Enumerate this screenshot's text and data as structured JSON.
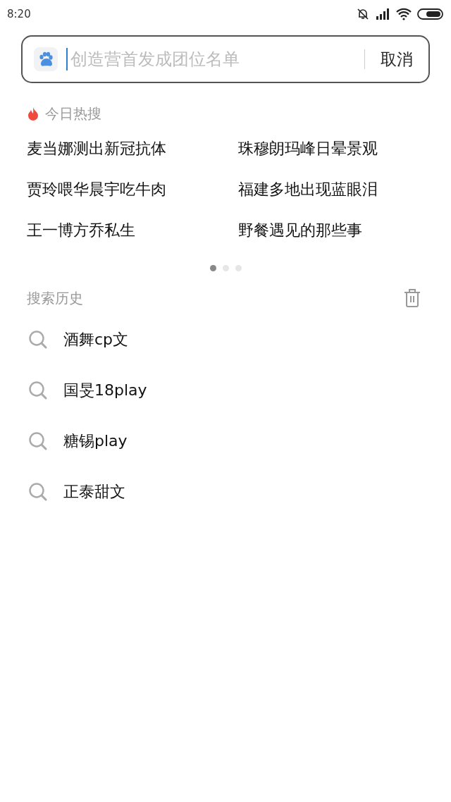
{
  "status_bar": {
    "time": "8:20"
  },
  "search": {
    "placeholder": "创造营首发成团位名单",
    "cancel": "取消"
  },
  "hot_search": {
    "title": "今日热搜",
    "items": [
      "麦当娜测出新冠抗体",
      "珠穆朗玛峰日晕景观",
      "贾玲喂华晨宇吃牛肉",
      "福建多地出现蓝眼泪",
      "王一博方乔私生",
      "野餐遇见的那些事"
    ],
    "pages": [
      {
        "selected": true
      },
      {
        "selected": false
      },
      {
        "selected": false
      }
    ]
  },
  "history": {
    "title": "搜索历史",
    "items": [
      "酒舞cp文",
      "国旻18play",
      "糖锡play",
      "正泰甜文"
    ]
  }
}
